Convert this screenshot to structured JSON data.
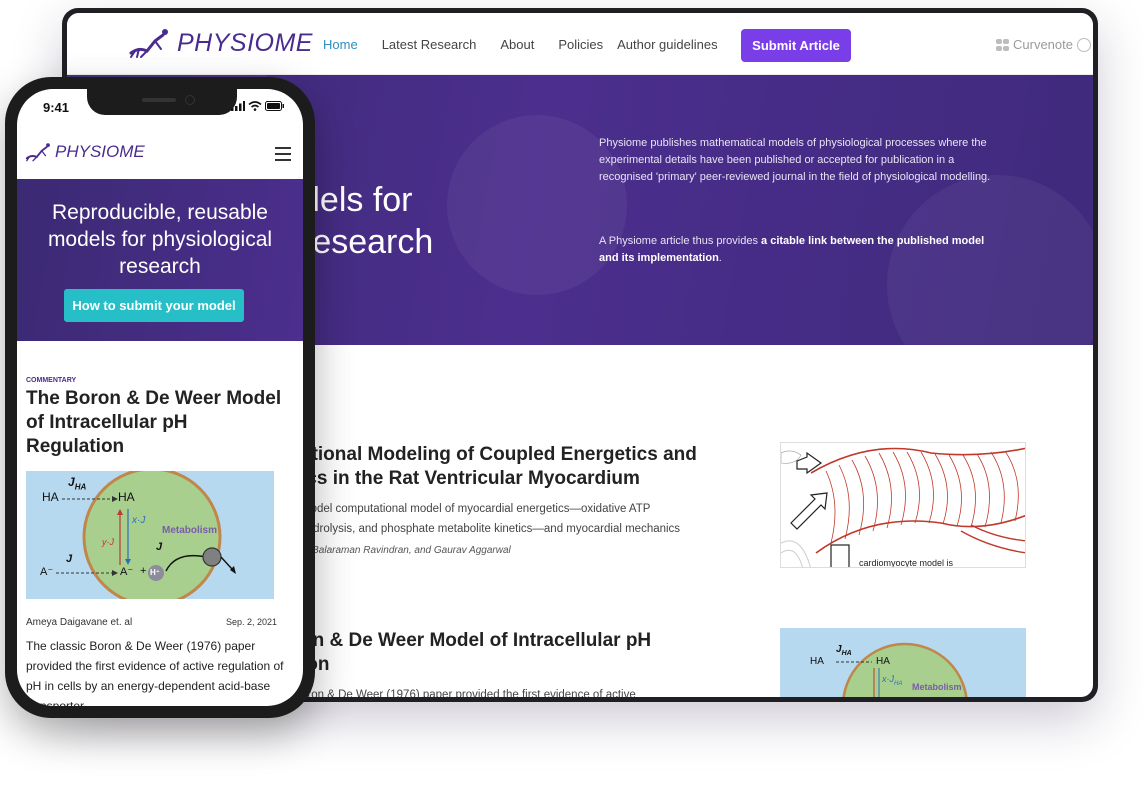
{
  "desktop": {
    "logo_text": "PHYSIOME",
    "nav": [
      {
        "label": "Home",
        "active": true
      },
      {
        "label": "Latest Research",
        "active": false
      },
      {
        "label": "About",
        "active": false
      },
      {
        "label": "Policies",
        "active": false
      },
      {
        "label": "Author guidelines",
        "active": false
      }
    ],
    "submit_label": "Submit Article",
    "curvenote_label": "Curvenote",
    "hero": {
      "line1": "dels for",
      "line2": "research",
      "desc": "Physiome publishes mathematical models of physiological processes where the experimental details have been published or accepted for publication in a recognised 'primary' peer-reviewed journal in the field of physiological modelling.",
      "p2_pre": "A Physiome article thus provides ",
      "p2_bold": "a citable link between the published model and its implementation",
      "p2_post": "."
    },
    "articles": [
      {
        "title_l1": "ational Modeling of Coupled Energetics and",
        "title_l2": "ics in the Rat Ventricular Myocardium",
        "desc_l1": "model computational model of myocardial energetics—oxidative ATP",
        "desc_l2": "hydrolysis, and phosphate metabolite kinetics—and myocardial mechanics",
        "authors": "e, Balaraman Ravindran, and Gaurav Aggarwal",
        "thumb_caption": "cardiomyocyte model is"
      },
      {
        "title_l1": "on & De Weer Model of Intracellular pH",
        "title_l2": "ion",
        "desc_l1": "oron & De Weer (1976) paper provided the first evidence of active"
      }
    ]
  },
  "phone": {
    "time": "9:41",
    "logo_text": "PHYSIOME",
    "hero_heading": "Reproducible, reusable models for physiological research",
    "cta_label": "How to submit your model",
    "category": "COMMENTARY",
    "title": "The Boron & De Weer Model of Intracellular pH Regulation",
    "author": "Ameya Daigavane et. al",
    "date": "Sep. 2, 2021",
    "desc": "The classic Boron & De Weer (1976) paper provided the first evidence of active regulation of pH in cells by an energy-dependent acid-base transporter."
  },
  "figure": {
    "j_ha": "J",
    "ha": "HA",
    "metabolism": "Metabolism",
    "a_minus": "A⁻",
    "h_plus": "H⁺",
    "x_jha": "x·J",
    "y_ja": "y·J"
  },
  "colors": {
    "brand_purple": "#4a2c8f",
    "submit_button": "#7a3ee8",
    "nav_active": "#2e8fc2",
    "cta_teal": "#27bfc7",
    "hero_bg": "#4c2e8e",
    "cell_green": "#a8cf8e",
    "cell_bg_blue": "#b6d9ef",
    "myocyte_red": "#c0392b"
  }
}
